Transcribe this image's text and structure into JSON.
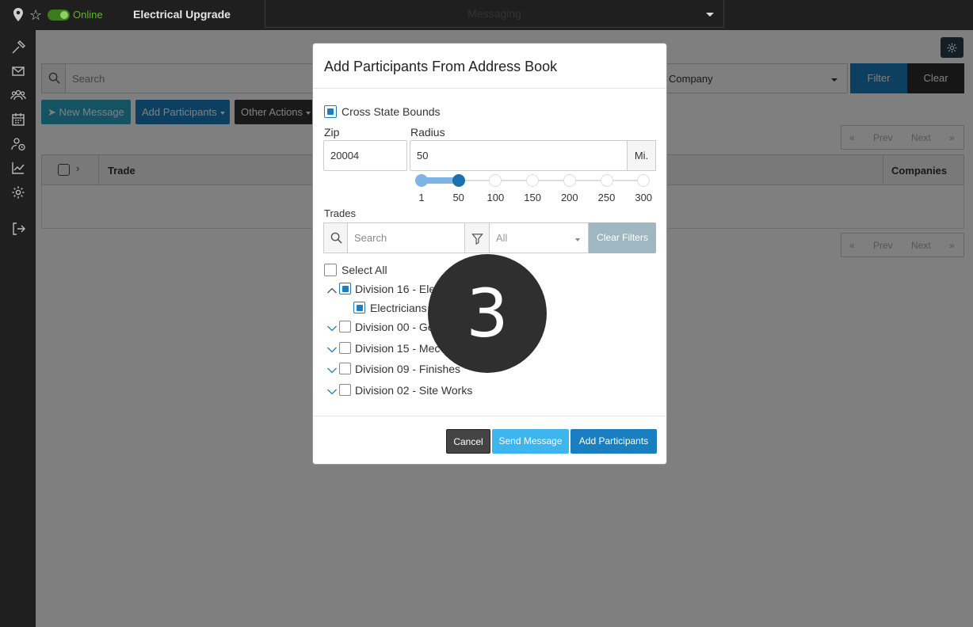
{
  "topbar": {
    "status": "Online",
    "project": "Electrical Upgrade",
    "module": "Messaging"
  },
  "background": {
    "page_title": "",
    "search_placeholder": "Search",
    "company_select": "Company",
    "filter_label": "Filter",
    "clear_label": "Clear",
    "new_message_label": "New Message",
    "add_participants_label": "Add Participants",
    "other_actions_label": "Other Actions",
    "pager": {
      "first": "«",
      "prev": "Prev",
      "next": "Next",
      "last": "»"
    },
    "table": {
      "col_trade": "Trade",
      "col_companies": "Companies"
    }
  },
  "modal": {
    "title": "Add Participants From Address Book",
    "cross_state_label": "Cross State Bounds",
    "cross_state_checked": true,
    "zip_label": "Zip",
    "zip_value": "20004",
    "radius_label": "Radius",
    "radius_value": "50",
    "radius_unit": "Mi.",
    "slider_ticks": [
      "1",
      "50",
      "100",
      "150",
      "200",
      "250",
      "300"
    ],
    "slider_range": [
      1,
      50
    ],
    "trades_label": "Trades",
    "trade_search_placeholder": "Search",
    "trade_filter_value": "All",
    "clear_filters_label": "Clear Filters",
    "select_all_label": "Select All",
    "tree": [
      {
        "label": "Division 16 - Ele",
        "expanded": true,
        "checked": true
      },
      {
        "label": "Electricians",
        "child": true,
        "checked": true
      },
      {
        "label": "Division 00 - Ge",
        "expanded": false,
        "checked": false
      },
      {
        "label": "Division 15 - Mec",
        "expanded": false,
        "checked": false
      },
      {
        "label": "Division 09 - Finishes",
        "expanded": false,
        "checked": false
      },
      {
        "label": "Division 02 - Site Works",
        "expanded": false,
        "checked": false
      }
    ],
    "cancel_label": "Cancel",
    "send_message_label": "Send Message",
    "add_participants_label": "Add Participants"
  },
  "step_marker": "3",
  "colors": {
    "primary": "#1a7fc1",
    "info": "#3db5ee",
    "online": "#5fb52a",
    "dark": "#1f1f1f"
  }
}
